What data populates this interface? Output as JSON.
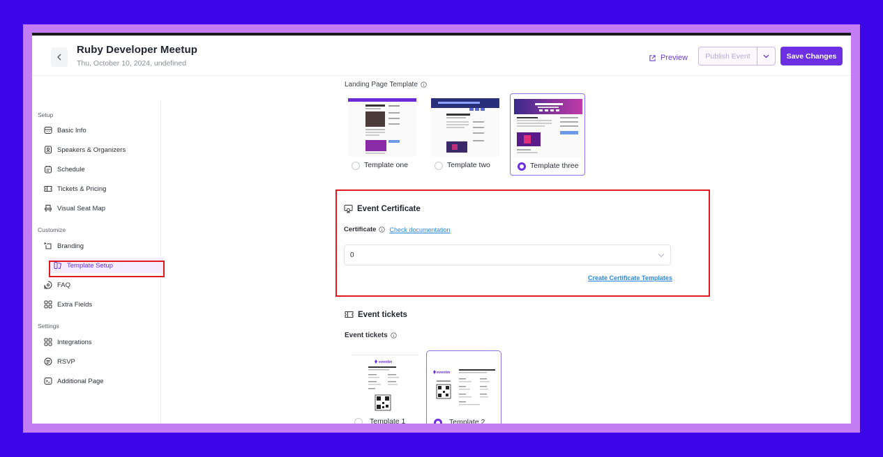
{
  "header": {
    "title": "Ruby Developer Meetup",
    "subtitle": "Thu, October 10, 2024, undefined",
    "preview_label": "Preview",
    "publish_label": "Publish Event",
    "save_label": "Save Changes"
  },
  "sidebar": {
    "sections": [
      {
        "label": "Setup"
      },
      {
        "label": "Customize"
      },
      {
        "label": "Settings"
      }
    ],
    "items": [
      {
        "label": "Basic Info",
        "icon": "basic-info-icon"
      },
      {
        "label": "Speakers & Organizers",
        "icon": "speakers-icon"
      },
      {
        "label": "Schedule",
        "icon": "schedule-icon"
      },
      {
        "label": "Tickets & Pricing",
        "icon": "ticket-icon"
      },
      {
        "label": "Visual Seat Map",
        "icon": "seat-map-icon"
      },
      {
        "label": "Branding",
        "icon": "branding-icon"
      },
      {
        "label": "Template Setup",
        "icon": "template-icon",
        "active": true
      },
      {
        "label": "FAQ",
        "icon": "faq-icon"
      },
      {
        "label": "Extra Fields",
        "icon": "extra-fields-icon"
      },
      {
        "label": "Integrations",
        "icon": "integrations-icon"
      },
      {
        "label": "RSVP",
        "icon": "rsvp-icon"
      },
      {
        "label": "Additional Page",
        "icon": "additional-page-icon"
      }
    ]
  },
  "landing": {
    "label": "Landing Page Template",
    "templates": [
      {
        "label": "Template one",
        "selected": false
      },
      {
        "label": "Template two",
        "selected": false
      },
      {
        "label": "Template three",
        "selected": true
      }
    ]
  },
  "certificate": {
    "title": "Event Certificate",
    "field_label": "Certificate",
    "doc_link": "Check documentation",
    "selected_value": "0",
    "create_link": "Create Certificate Templates"
  },
  "tickets": {
    "title": "Event tickets",
    "label": "Event tickets",
    "brand": "eventin",
    "templates": [
      {
        "label": "Template 1",
        "selected": false
      },
      {
        "label": "Template 2",
        "selected": true
      }
    ]
  },
  "colors": {
    "background": "#3b07e8",
    "frame": "#c27cf4",
    "accent": "#6c2fe3",
    "highlight": "#e0191c",
    "link": "#2e86de"
  }
}
